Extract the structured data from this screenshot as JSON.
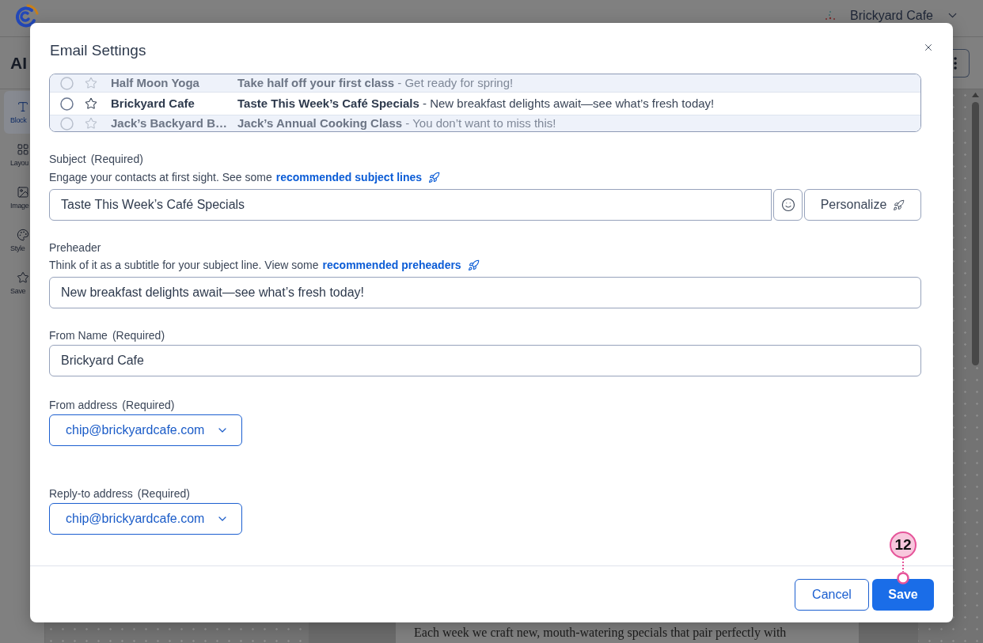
{
  "header": {
    "account_name": "Brickyard Cafe"
  },
  "toolbar": {
    "title": "AI"
  },
  "sidebar": {
    "items": [
      {
        "label": "Block",
        "kind": "text",
        "selected": true
      },
      {
        "label": "Layou",
        "kind": "layout",
        "selected": false
      },
      {
        "label": "Image",
        "kind": "image",
        "selected": false
      },
      {
        "label": "Style",
        "kind": "style",
        "selected": false
      },
      {
        "label": "Save",
        "kind": "saved",
        "selected": false
      }
    ]
  },
  "canvas": {
    "body_text": "Each week we craft new, mouth-watering specials that pair perfectly with"
  },
  "dialog": {
    "title": "Email Settings",
    "inbox_preview": [
      {
        "sender": "Half Moon Yoga",
        "message": "**Take half off your first class** - Get ready for spring!",
        "faded": true
      },
      {
        "sender": "Brickyard Cafe",
        "message": "**Taste This Week’s Café Specials** - New breakfast delights await—see what’s fresh today!",
        "faded": false
      },
      {
        "sender": "Jack’s Backyard B…",
        "message": "**Jack’s Annual Cooking Class** - You don’t want to miss this!",
        "faded": true
      }
    ],
    "subject": {
      "label": "Subject",
      "note": "(Required)",
      "help": "Engage your contacts at first sight. See some",
      "link": "recommended subject lines",
      "value": "Taste This Week’s Café Specials",
      "personalize_button": "Personalize"
    },
    "preheader": {
      "label": "Preheader",
      "help": "Think of it as a subtitle for your subject line. View some",
      "link": "recommended preheaders",
      "value": "New breakfast delights await—see what’s fresh today!"
    },
    "from_name": {
      "label": "From Name",
      "note": "(Required)",
      "value": "Brickyard Cafe"
    },
    "from_address": {
      "label": "From address",
      "note": "(Required)",
      "value": "chip@brickyardcafe.com"
    },
    "reply_to_address": {
      "label": "Reply-to address",
      "note": "(Required)",
      "value": "chip@brickyardcafe.com"
    },
    "buttons": {
      "cancel": "Cancel",
      "save": "Save"
    }
  },
  "annotation": {
    "step": "12"
  }
}
